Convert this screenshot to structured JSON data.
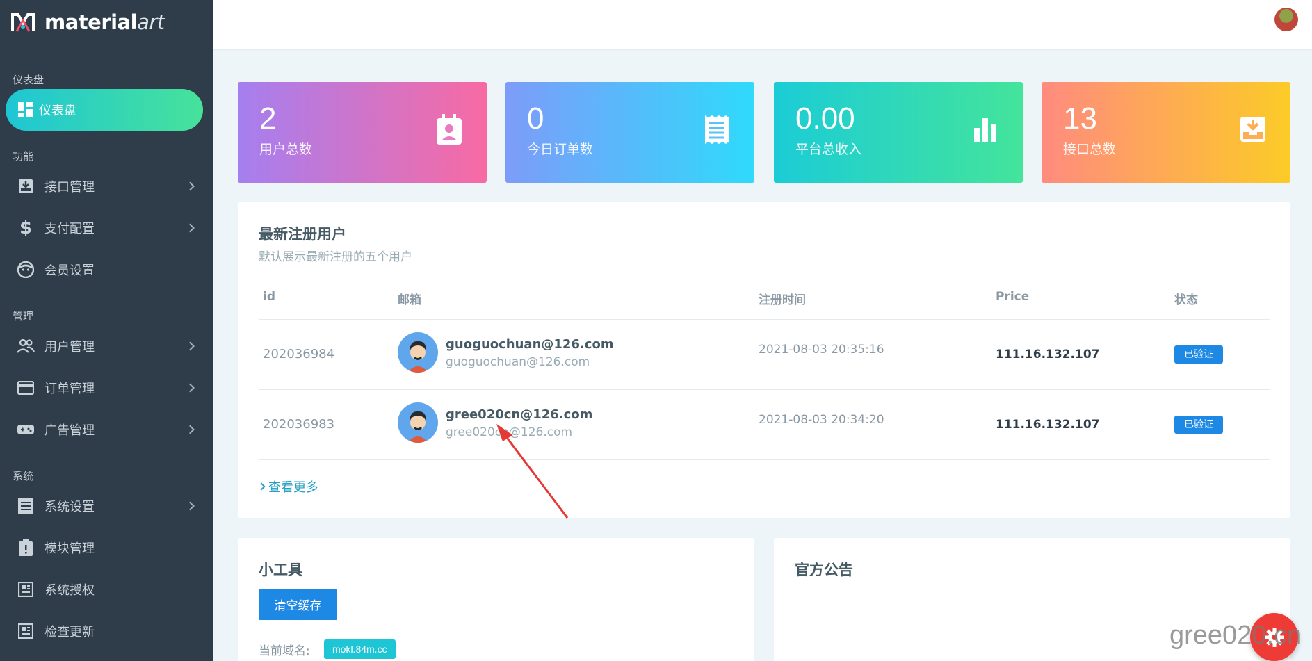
{
  "brand": {
    "name_main": "material",
    "name_accent": "art"
  },
  "sidebar": {
    "sections": {
      "dashboard": "仪表盘",
      "features": "功能",
      "manage": "管理",
      "system": "系统"
    },
    "items": [
      {
        "label": "仪表盘",
        "icon": "dashboard-icon"
      },
      {
        "label": "接口管理",
        "icon": "inbox-icon"
      },
      {
        "label": "支付配置",
        "icon": "dollar-icon"
      },
      {
        "label": "会员设置",
        "icon": "face-icon"
      },
      {
        "label": "用户管理",
        "icon": "users-icon"
      },
      {
        "label": "订单管理",
        "icon": "credit-card-icon"
      },
      {
        "label": "广告管理",
        "icon": "gamepad-icon"
      },
      {
        "label": "系统设置",
        "icon": "list-icon"
      },
      {
        "label": "模块管理",
        "icon": "clipboard-alert-icon"
      },
      {
        "label": "系统授权",
        "icon": "certificate-icon"
      },
      {
        "label": "检查更新",
        "icon": "newspaper-icon"
      }
    ]
  },
  "stats": [
    {
      "value": "2",
      "label": "用户总数",
      "icon": "contact-icon"
    },
    {
      "value": "0",
      "label": "今日订单数",
      "icon": "receipt-icon"
    },
    {
      "value": "0.00",
      "label": "平台总收入",
      "icon": "bar-chart-icon"
    },
    {
      "value": "13",
      "label": "接口总数",
      "icon": "inbox-arrow-icon"
    }
  ],
  "users": {
    "title": "最新注册用户",
    "subtitle": "默认展示最新注册的五个用户",
    "columns": {
      "id": "id",
      "email": "邮箱",
      "time": "注册时间",
      "price": "Price",
      "status": "状态"
    },
    "rows": [
      {
        "id": "202036984",
        "email": "guoguochuan@126.com",
        "email_sub": "guoguochuan@126.com",
        "time": "2021-08-03 20:35:16",
        "price": "111.16.132.107",
        "status": "已验证"
      },
      {
        "id": "202036983",
        "email": "gree020cn@126.com",
        "email_sub": "gree020cn@126.com",
        "time": "2021-08-03 20:34:20",
        "price": "111.16.132.107",
        "status": "已验证"
      }
    ],
    "more": "查看更多"
  },
  "tools": {
    "title": "小工具",
    "clear_button": "清空缓存",
    "domain_label": "当前域名:",
    "domain_value": "mokl.84m.cc"
  },
  "notice": {
    "title": "官方公告"
  },
  "watermark": "gree020.cn",
  "colors": {
    "sidebar": "#2f3d4a",
    "accent_blue": "#1e88e5",
    "teal": "#1ec6d5",
    "fab": "#ef3b36"
  }
}
